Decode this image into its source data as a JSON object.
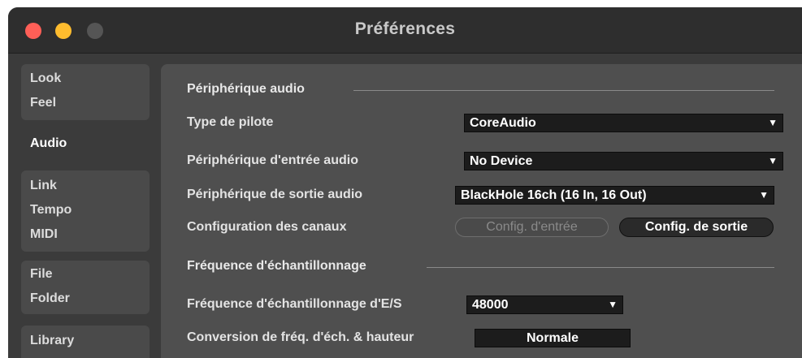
{
  "window": {
    "title": "Préférences"
  },
  "sidebar": {
    "groups": [
      {
        "items": [
          "Look",
          "Feel"
        ]
      },
      {
        "items": [
          "Audio"
        ]
      },
      {
        "items": [
          "Link",
          "Tempo",
          "MIDI"
        ]
      },
      {
        "items": [
          "File",
          "Folder"
        ]
      },
      {
        "items": [
          "Library"
        ]
      }
    ],
    "selected": "Audio"
  },
  "audio_device": {
    "section_title": "Périphérique audio",
    "driver_type": {
      "label": "Type de pilote",
      "value": "CoreAudio"
    },
    "input_device": {
      "label": "Périphérique d'entrée audio",
      "value": "No Device"
    },
    "output_device": {
      "label": "Périphérique de sortie audio",
      "value": "BlackHole 16ch (16 In, 16 Out)"
    },
    "channels": {
      "label": "Configuration des canaux",
      "input_button": "Config. d'entrée",
      "output_button": "Config. de sortie"
    }
  },
  "sample_rate": {
    "section_title": "Fréquence d'échantillonnage",
    "io_rate": {
      "label": "Fréquence d'échantillonnage d'E/S",
      "value": "48000"
    },
    "conversion": {
      "label": "Conversion de fréq. d'éch. & hauteur",
      "value": "Normale"
    }
  },
  "icons": {
    "dropdown": "▼"
  },
  "colors": {
    "close": "#ff5f57",
    "minimize": "#febc2e",
    "zoom": "#555555"
  }
}
